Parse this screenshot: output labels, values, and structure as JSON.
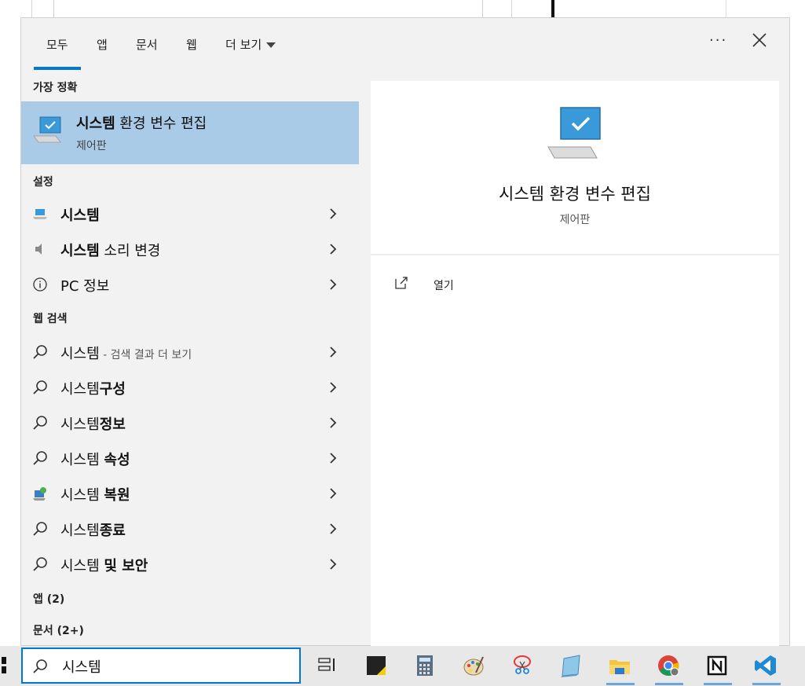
{
  "tabs": [
    {
      "label": "모두",
      "active": true
    },
    {
      "label": "앱"
    },
    {
      "label": "문서"
    },
    {
      "label": "웹"
    },
    {
      "label": "더 보기"
    }
  ],
  "header_icons": [
    "more-options-icon",
    "close-icon"
  ],
  "sections": {
    "best_match": "가장 정확",
    "settings": "설정",
    "web": "웹 검색",
    "apps": "앱 (2)",
    "docs": "문서 (2+)"
  },
  "best_match": {
    "title_bold": "시스템",
    "title_rest": " 환경 변수 편집",
    "subtitle": "제어판"
  },
  "settings_items": [
    {
      "bold": "시스템",
      "rest": "",
      "icon": "laptop-icon"
    },
    {
      "bold": "시스템",
      "rest": " 소리 변경",
      "icon": "speaker-icon"
    },
    {
      "bold": "",
      "rest": "PC 정보",
      "icon": "info-icon"
    }
  ],
  "web_items": [
    {
      "normal": "시스템",
      "bold": "",
      "hint": " - 검색 결과 더 보기"
    },
    {
      "normal": "시스템",
      "bold": "구성",
      "hint": ""
    },
    {
      "normal": "시스템",
      "bold": "정보",
      "hint": ""
    },
    {
      "normal": "시스템 ",
      "bold": "속성",
      "hint": ""
    },
    {
      "normal": "시스템 ",
      "bold": "복원",
      "hint": "",
      "icon": "restore-icon"
    },
    {
      "normal": "시스템",
      "bold": "종료",
      "hint": ""
    },
    {
      "normal": "시스템 ",
      "bold": "및 보안",
      "hint": ""
    }
  ],
  "detail": {
    "title": "시스템 환경 변수 편집",
    "subtitle": "제어판",
    "open_label": "열기"
  },
  "search": {
    "value": "시스템"
  },
  "taskbar_icons": [
    "task-view-icon",
    "sticky-notes-icon",
    "calculator-icon",
    "paint-icon",
    "snipping-tool-icon",
    "notepad-icon",
    "file-explorer-icon",
    "chrome-icon",
    "notion-icon",
    "vscode-icon"
  ],
  "colors": {
    "accent": "#0078d4",
    "best_match_bg": "#a9cbe8",
    "panel_bg": "#f2f2f2"
  }
}
